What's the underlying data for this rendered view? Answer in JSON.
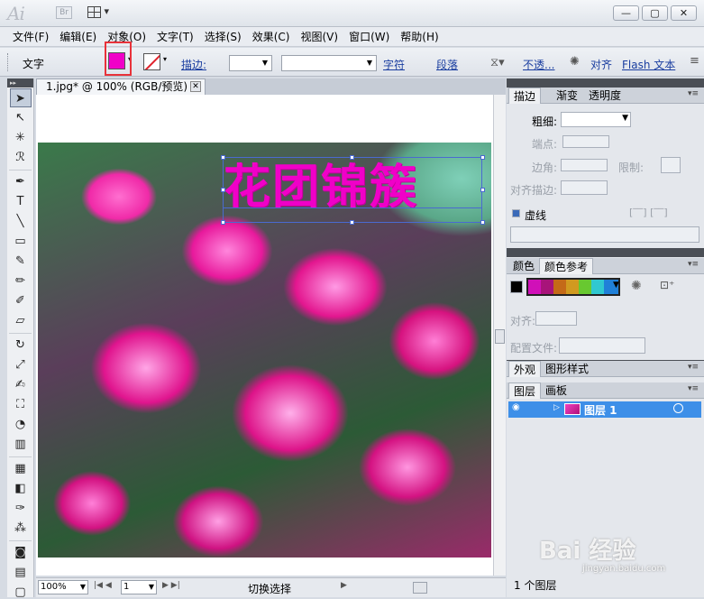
{
  "app": {
    "logo": "Ai",
    "bridge_label": "Br",
    "window_controls": [
      "—",
      "▢",
      "✕"
    ]
  },
  "menu": [
    "文件(F)",
    "编辑(E)",
    "对象(O)",
    "文字(T)",
    "选择(S)",
    "效果(C)",
    "视图(V)",
    "窗口(W)",
    "帮助(H)"
  ],
  "control_bar": {
    "mode_label": "文字",
    "fill_color": "#f000c8",
    "stroke_label": "描边:",
    "char_link": "字符",
    "para_link": "段落",
    "opacity_link": "不透...",
    "align_label": "对齐",
    "flash_link": "Flash 文本"
  },
  "document": {
    "tab_title": "1.jpg* @ 100% (RGB/预览)",
    "canvas_text": "花团锦簇",
    "text_color": "#f000c8"
  },
  "status": {
    "zoom": "100%",
    "page": "1",
    "mode": "切换选择"
  },
  "panels": {
    "stroke_tabs": [
      "描边",
      "渐变",
      "透明度"
    ],
    "weight_label": "粗细:",
    "cap_label": "端点:",
    "corner_label": "边角:",
    "limit_label": "限制:",
    "align_stroke_label": "对齐描边:",
    "dashed_label": "虚线",
    "color_tabs": [
      "颜色",
      "颜色参考"
    ],
    "align_label": "对齐:",
    "preset_label": "配置文件:",
    "appearance_tabs": [
      "外观",
      "图形样式"
    ],
    "layer_tabs": [
      "图层",
      "画板"
    ],
    "layer_name": "图层 1",
    "layer_count": "1 个图层"
  },
  "watermark": {
    "brand": "Bai 经验",
    "url": "jingyan.baidu.com"
  }
}
